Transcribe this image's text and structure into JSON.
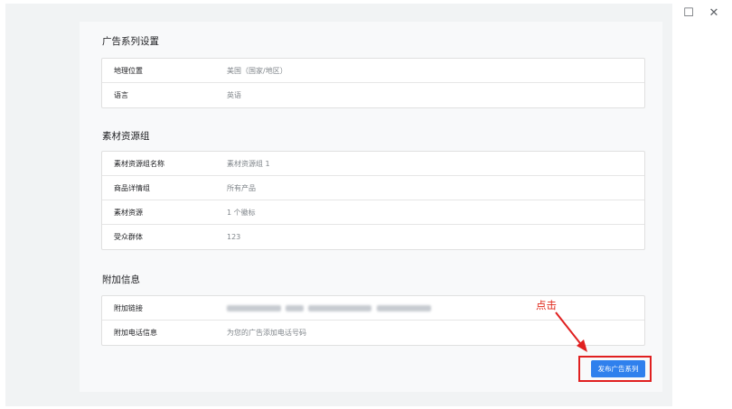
{
  "window_controls": {
    "minimize": "—",
    "maximize": "☐",
    "close": "✕"
  },
  "sections": [
    {
      "title": "广告系列设置",
      "rows": [
        {
          "label": "地理位置",
          "value": "美国（国家/地区）"
        },
        {
          "label": "语言",
          "value": "英语"
        }
      ]
    },
    {
      "title": "素材资源组",
      "rows": [
        {
          "label": "素材资源组名称",
          "value": "素材资源组 1"
        },
        {
          "label": "商品详情组",
          "value": "所有产品"
        },
        {
          "label": "素材资源",
          "value": "1 个徽标"
        },
        {
          "label": "受众群体",
          "value": "123"
        }
      ]
    },
    {
      "title": "附加信息",
      "rows": [
        {
          "label": "附加链接",
          "value": ""
        },
        {
          "label": "附加电话信息",
          "value": "为您的广告添加电话号码"
        }
      ]
    }
  ],
  "annotation": {
    "text": "点击",
    "color": "#e0281b"
  },
  "publish_button": {
    "label": "发布广告系列",
    "color": "#2f80ed"
  }
}
